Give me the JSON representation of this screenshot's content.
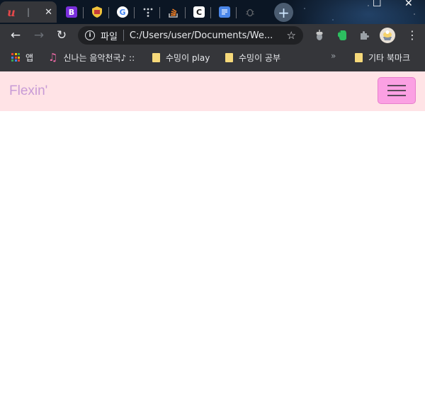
{
  "browser": {
    "tabs": [
      {
        "icon": "udemy-icon",
        "active": true,
        "close": "✕",
        "separator": "|"
      },
      {
        "icon": "bootstrap-icon",
        "letter": "B",
        "color": "#7a2fdc"
      },
      {
        "icon": "shield-extension-icon"
      },
      {
        "icon": "google-icon",
        "letter": "G"
      },
      {
        "icon": "dots-grid-icon"
      },
      {
        "icon": "stackoverflow-icon"
      },
      {
        "icon": "codepen-icon",
        "letter": "C"
      },
      {
        "icon": "docs-icon"
      },
      {
        "icon": "bug-icon"
      }
    ],
    "new_tab": "+",
    "window_controls": {
      "minimize": "–",
      "maximize": "☐",
      "close": "✕"
    },
    "toolbar": {
      "back": "←",
      "forward": "→",
      "reload": "↻",
      "security_chip": "파일",
      "url": "C:/Users/user/Documents/We...",
      "star": "☆",
      "menu": "⋮"
    },
    "bookmarks": [
      {
        "label": "앱",
        "icon": "apps-icon"
      },
      {
        "label": "신나는 음악천국♪ ::",
        "icon": "music-note-icon"
      },
      {
        "label": "수밍이 play",
        "icon": "folder-icon"
      },
      {
        "label": "수밍이 공부",
        "icon": "folder-icon"
      },
      {
        "label": "기타 북마크",
        "icon": "folder-icon"
      }
    ],
    "bookmarks_overflow": "»"
  },
  "page": {
    "brand": "Flexin'",
    "colors": {
      "navbar_bg": "#ffe3e6",
      "brand": "#c89bd6",
      "toggler_bg": "#fba0e3"
    }
  }
}
